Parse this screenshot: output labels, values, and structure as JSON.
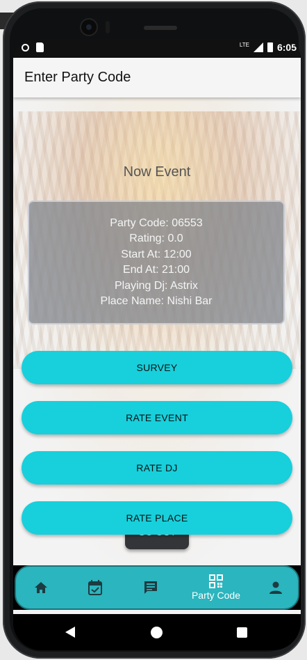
{
  "statusbar": {
    "network": "LTE",
    "time": "6:05"
  },
  "appbar": {
    "title": "Enter Party Code"
  },
  "event": {
    "heading": "Now Event",
    "party_code": "Party Code: 06553",
    "rating": "Rating: 0.0",
    "start": "Start At: 12:00",
    "end": "End At: 21:00",
    "dj": "Playing Dj: Astrix",
    "place": "Place Name: Nishi Bar"
  },
  "actions": {
    "survey": "SURVEY",
    "rate_event": "RATE EVENT",
    "rate_dj": "RATE DJ",
    "rate_place": "RATE PLACE",
    "go_out": "GO OUT"
  },
  "bottom_nav": {
    "items": [
      {
        "icon": "home-icon",
        "label": ""
      },
      {
        "icon": "calendar-check-icon",
        "label": ""
      },
      {
        "icon": "message-icon",
        "label": ""
      },
      {
        "icon": "qr-code-icon",
        "label": "Party Code",
        "selected": true
      },
      {
        "icon": "person-icon",
        "label": ""
      }
    ]
  },
  "colors": {
    "accent": "#17d0dc",
    "nav_background": "#2bb5be",
    "dark_button": "#333538"
  }
}
